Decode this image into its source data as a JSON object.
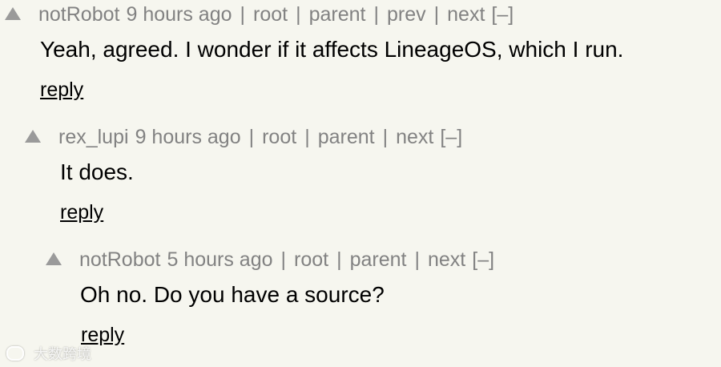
{
  "comments": [
    {
      "user": "notRobot",
      "age": "9 hours ago",
      "links": {
        "root": "root",
        "parent": "parent",
        "prev": "prev",
        "next": "next",
        "toggle": "[–]"
      },
      "separator": "|",
      "text": "Yeah, agreed. I wonder if it affects LineageOS, which I run.",
      "reply": "reply"
    },
    {
      "user": "rex_lupi",
      "age": "9 hours ago",
      "links": {
        "root": "root",
        "parent": "parent",
        "next": "next",
        "toggle": "[–]"
      },
      "separator": "|",
      "text": "It does.",
      "reply": "reply"
    },
    {
      "user": "notRobot",
      "age": "5 hours ago",
      "links": {
        "root": "root",
        "parent": "parent",
        "next": "next",
        "toggle": "[–]"
      },
      "separator": "|",
      "text": "Oh no. Do you have a source?",
      "reply": "reply"
    }
  ],
  "watermark": {
    "text": "大数跨境",
    "icon": "logo-icon"
  },
  "colors": {
    "background": "#f6f6ef",
    "meta": "#828282",
    "text": "#000000"
  },
  "icons": {
    "vote": "upvote-triangle-icon"
  }
}
